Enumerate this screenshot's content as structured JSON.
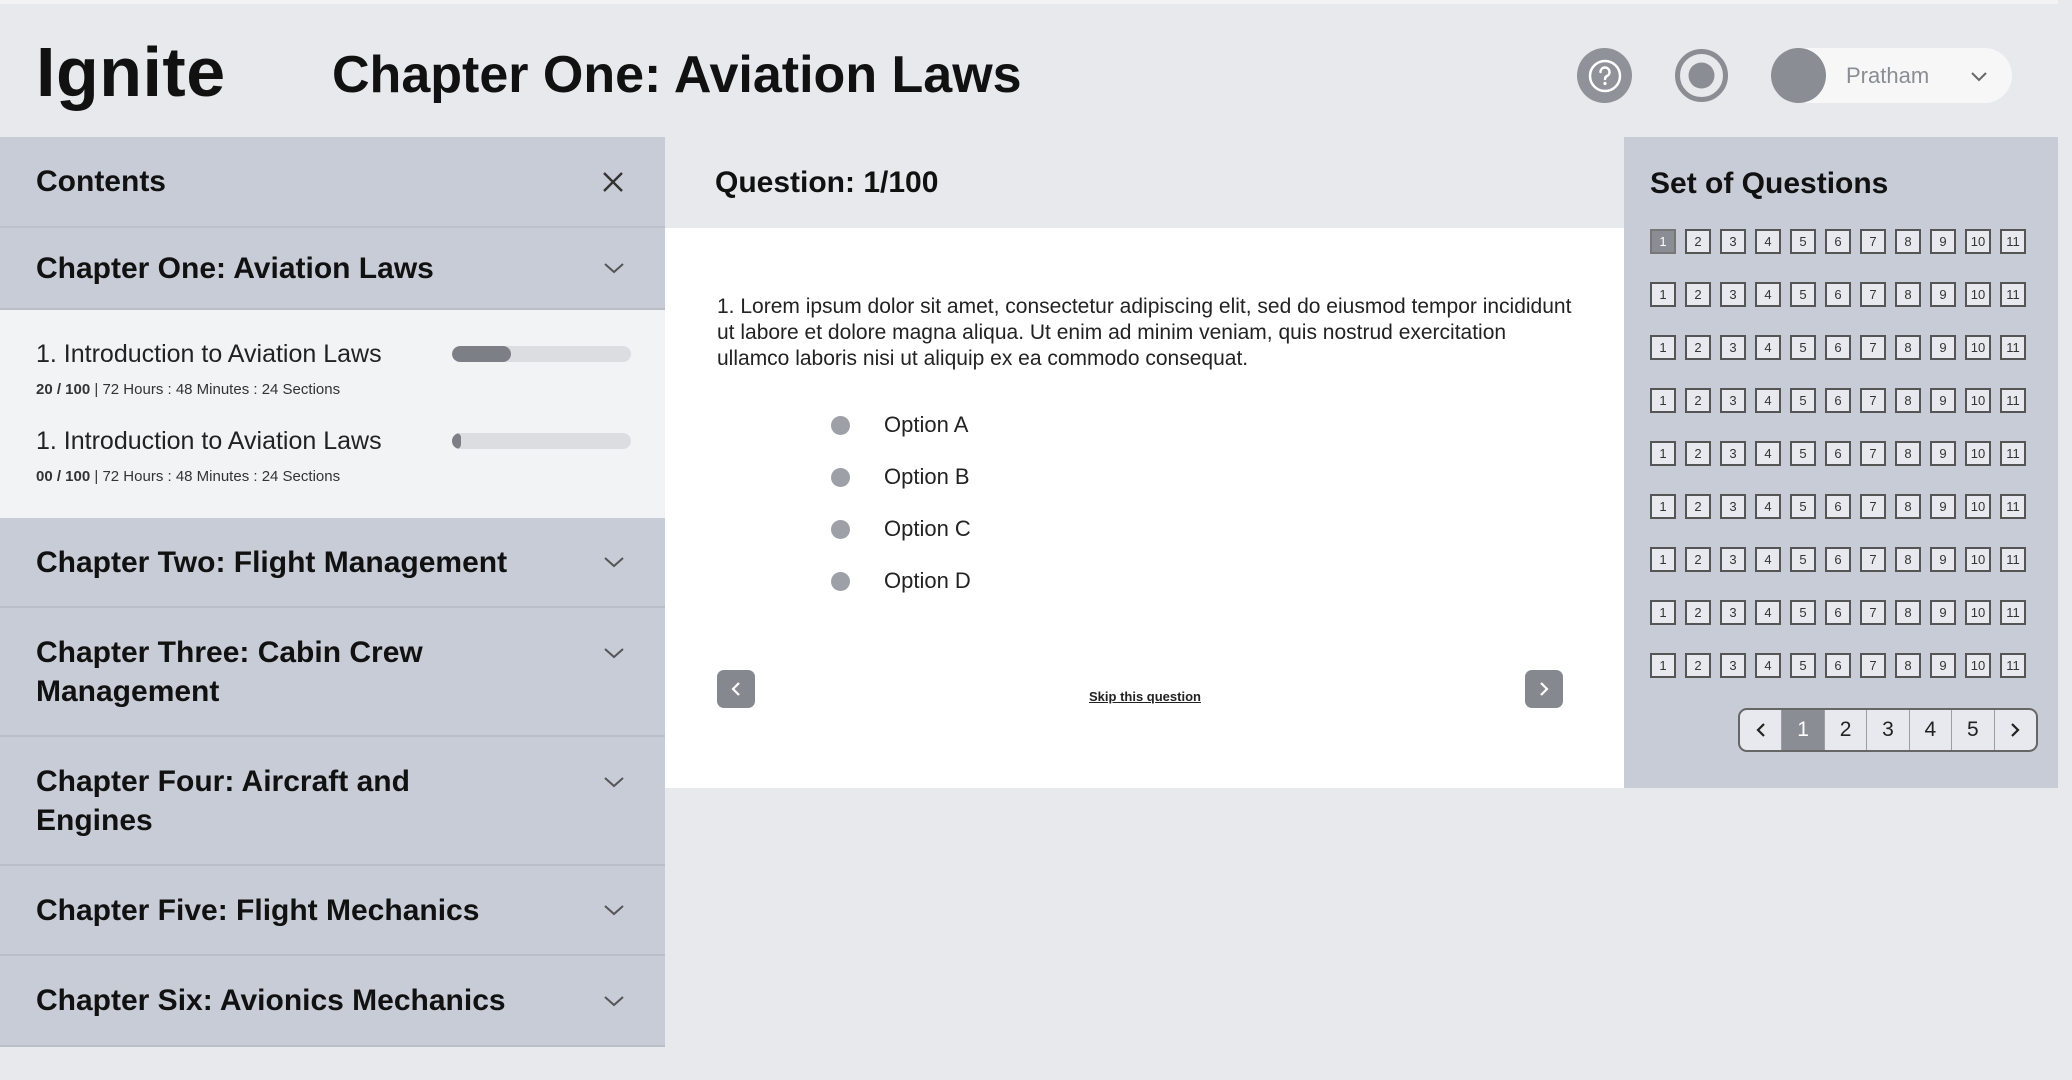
{
  "header": {
    "logo": "Ignite",
    "title": "Chapter One: Aviation Laws",
    "help_icon": "question-circle-icon",
    "record_icon": "record-icon",
    "user": {
      "name": "Pratham"
    }
  },
  "sidebar": {
    "title": "Contents",
    "chapters": [
      {
        "label": "Chapter One: Aviation Laws",
        "expanded": true
      },
      {
        "label": "Chapter Two: Flight Management"
      },
      {
        "label": "Chapter Three: Cabin Crew Management"
      },
      {
        "label": "Chapter Four: Aircraft and Engines"
      },
      {
        "label": "Chapter Five: Flight Mechanics"
      },
      {
        "label": "Chapter Six: Avionics Mechanics"
      }
    ],
    "lessons": [
      {
        "title": "1. Introduction to Aviation Laws",
        "score": "20 / 100",
        "details": "72 Hours : 48 Minutes : 24 Sections",
        "progress": 0.33
      },
      {
        "title": "1. Introduction to Aviation Laws",
        "score": "00 / 100",
        "details": "72 Hours : 48 Minutes : 24 Sections",
        "progress": 0.05
      }
    ]
  },
  "question": {
    "heading": "Question: 1/100",
    "text": "1. Lorem ipsum dolor sit amet, consectetur adipiscing elit, sed do eiusmod tempor incididunt ut labore et dolore magna aliqua. Ut enim ad minim veniam, quis nostrud exercitation ullamco laboris nisi ut aliquip ex ea commodo consequat.",
    "options": [
      "Option A",
      "Option B",
      "Option C",
      "Option D"
    ],
    "skip_label": "Skip this question"
  },
  "question_set": {
    "title": "Set of Questions",
    "numbers": [
      "1",
      "2",
      "3",
      "4",
      "5",
      "6",
      "7",
      "8",
      "9",
      "10",
      "11"
    ],
    "row_count": 9,
    "active_number": "1",
    "pages": [
      "1",
      "2",
      "3",
      "4",
      "5"
    ],
    "active_page": "1"
  }
}
